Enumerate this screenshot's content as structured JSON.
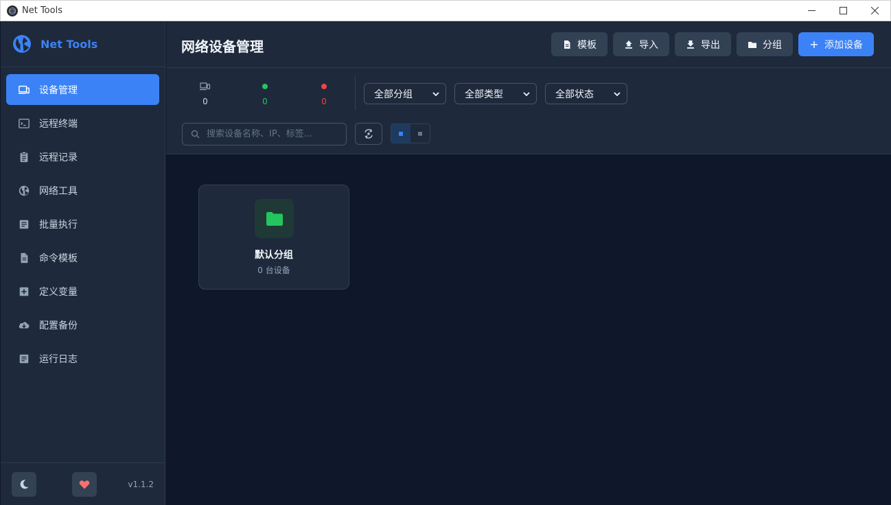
{
  "window": {
    "title": "Net Tools"
  },
  "brand": {
    "name": "Net Tools",
    "color": "#3b82f6"
  },
  "sidebar": {
    "items": [
      {
        "label": "设备管理",
        "icon": "devices-icon",
        "active": true
      },
      {
        "label": "远程终端",
        "icon": "terminal-icon",
        "active": false
      },
      {
        "label": "远程记录",
        "icon": "clipboard-icon",
        "active": false
      },
      {
        "label": "网络工具",
        "icon": "globe-icon",
        "active": false
      },
      {
        "label": "批量执行",
        "icon": "list-doc-icon",
        "active": false
      },
      {
        "label": "命令模板",
        "icon": "file-icon",
        "active": false
      },
      {
        "label": "定义变量",
        "icon": "plus-box-icon",
        "active": false
      },
      {
        "label": "配置备份",
        "icon": "cloud-download-icon",
        "active": false
      },
      {
        "label": "运行日志",
        "icon": "log-icon",
        "active": false
      }
    ],
    "version": "v1.1.2"
  },
  "header": {
    "title": "网络设备管理",
    "buttons": {
      "template": "模板",
      "import": "导入",
      "export": "导出",
      "group": "分组",
      "add_device": "添加设备"
    }
  },
  "stats": {
    "total": "0",
    "online": "0",
    "offline": "0"
  },
  "filters": {
    "group": "全部分组",
    "type": "全部类型",
    "status": "全部状态"
  },
  "search": {
    "placeholder": "搜索设备名称、IP、标签..."
  },
  "groups": [
    {
      "name": "默认分组",
      "count": "0 台设备"
    }
  ],
  "colors": {
    "accent": "#3b82f6",
    "online": "#22c55e",
    "offline": "#ef4444",
    "folder": "#22c55e"
  }
}
